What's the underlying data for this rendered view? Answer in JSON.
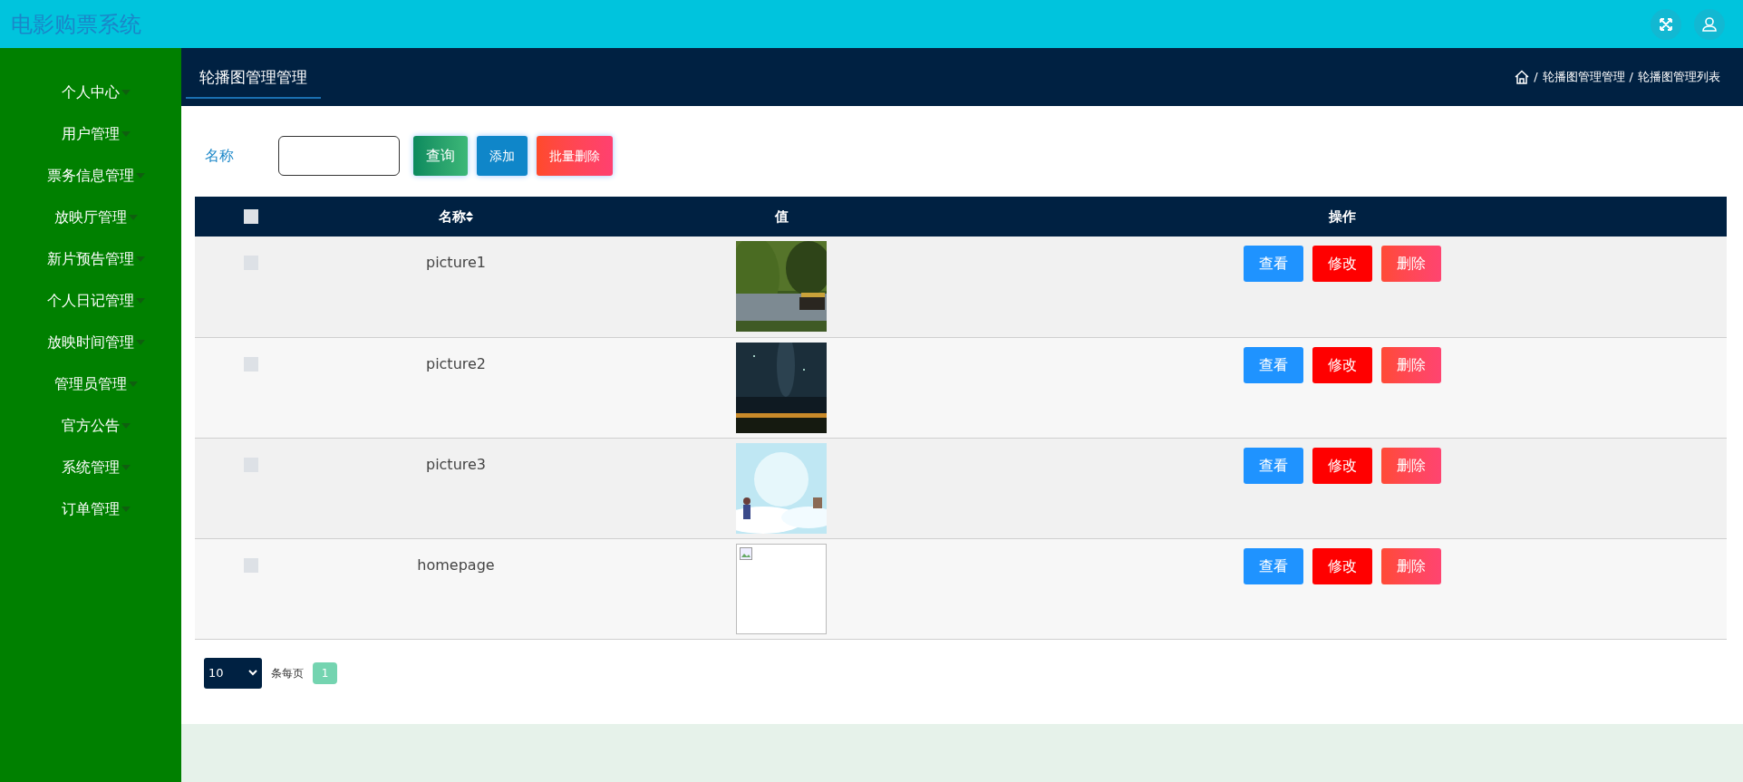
{
  "app_title": "电影购票系统",
  "sidebar": {
    "items": [
      {
        "label": "个人中心"
      },
      {
        "label": "用户管理"
      },
      {
        "label": "票务信息管理"
      },
      {
        "label": "放映厅管理"
      },
      {
        "label": "新片预告管理"
      },
      {
        "label": "个人日记管理"
      },
      {
        "label": "放映时间管理"
      },
      {
        "label": "管理员管理"
      },
      {
        "label": "官方公告"
      },
      {
        "label": "系统管理"
      },
      {
        "label": "订单管理"
      }
    ]
  },
  "page_tab": "轮播图管理管理",
  "breadcrumb": {
    "separator": "/",
    "items": [
      "轮播图管理管理",
      "轮播图管理列表"
    ]
  },
  "search": {
    "label": "名称",
    "buttons": [
      {
        "label": "查询",
        "kind": "query"
      },
      {
        "label": "添加",
        "kind": "add"
      },
      {
        "label": "批量删除",
        "kind": "batch-delete"
      }
    ]
  },
  "table": {
    "select_all_checked": false,
    "columns": [
      "名称",
      "值",
      "操作"
    ],
    "rows": [
      {
        "checked": false,
        "name": "picture1",
        "image": {
          "kind": "picture"
        },
        "actions": [
          {
            "label": "查看",
            "kind": "view"
          },
          {
            "label": "修改",
            "kind": "edit"
          },
          {
            "label": "删除",
            "kind": "delete"
          }
        ]
      },
      {
        "checked": false,
        "name": "picture2",
        "image": {
          "kind": "picture"
        },
        "actions": [
          {
            "label": "查看",
            "kind": "view"
          },
          {
            "label": "修改",
            "kind": "edit"
          },
          {
            "label": "删除",
            "kind": "delete"
          }
        ]
      },
      {
        "checked": false,
        "name": "picture3",
        "image": {
          "kind": "picture"
        },
        "actions": [
          {
            "label": "查看",
            "kind": "view"
          },
          {
            "label": "修改",
            "kind": "edit"
          },
          {
            "label": "删除",
            "kind": "delete"
          }
        ]
      },
      {
        "checked": false,
        "name": "homepage",
        "image": {
          "kind": "broken"
        },
        "actions": [
          {
            "label": "查看",
            "kind": "view"
          },
          {
            "label": "修改",
            "kind": "edit"
          },
          {
            "label": "删除",
            "kind": "delete"
          }
        ]
      }
    ]
  },
  "pagination": {
    "page_size": "10",
    "per_page_label": "条每页",
    "pages": [
      {
        "label": "1",
        "selected": true
      }
    ]
  }
}
